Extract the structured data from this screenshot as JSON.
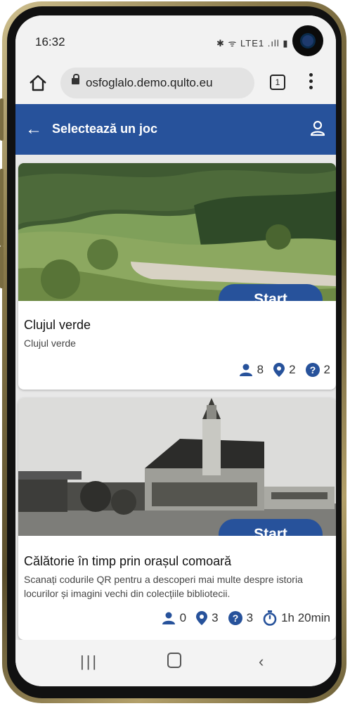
{
  "status_bar": {
    "time": "16:32",
    "icons_text": "✱ ᯤ LTE1 .ıll ▮"
  },
  "browser": {
    "url": "osfoglalo.demo.qulto.eu",
    "tab_count": "1"
  },
  "app_bar": {
    "title": "Selectează un joc"
  },
  "games": [
    {
      "title": "Clujul verde",
      "description": "Clujul verde",
      "start_label": "Start",
      "stats": {
        "players": "8",
        "locations": "2",
        "questions": "2"
      }
    },
    {
      "title": "Călătorie în timp prin orașul comoară",
      "description": "Scanați codurile QR pentru a descoperi mai multe despre istoria locurilor și imagini vechi din colecțiile bibliotecii.",
      "start_label": "Start",
      "stats": {
        "players": "0",
        "locations": "3",
        "questions": "3",
        "duration": "1h 20min"
      }
    }
  ],
  "colors": {
    "brand": "#27529b",
    "frame_gold": "#8a7a4b"
  }
}
